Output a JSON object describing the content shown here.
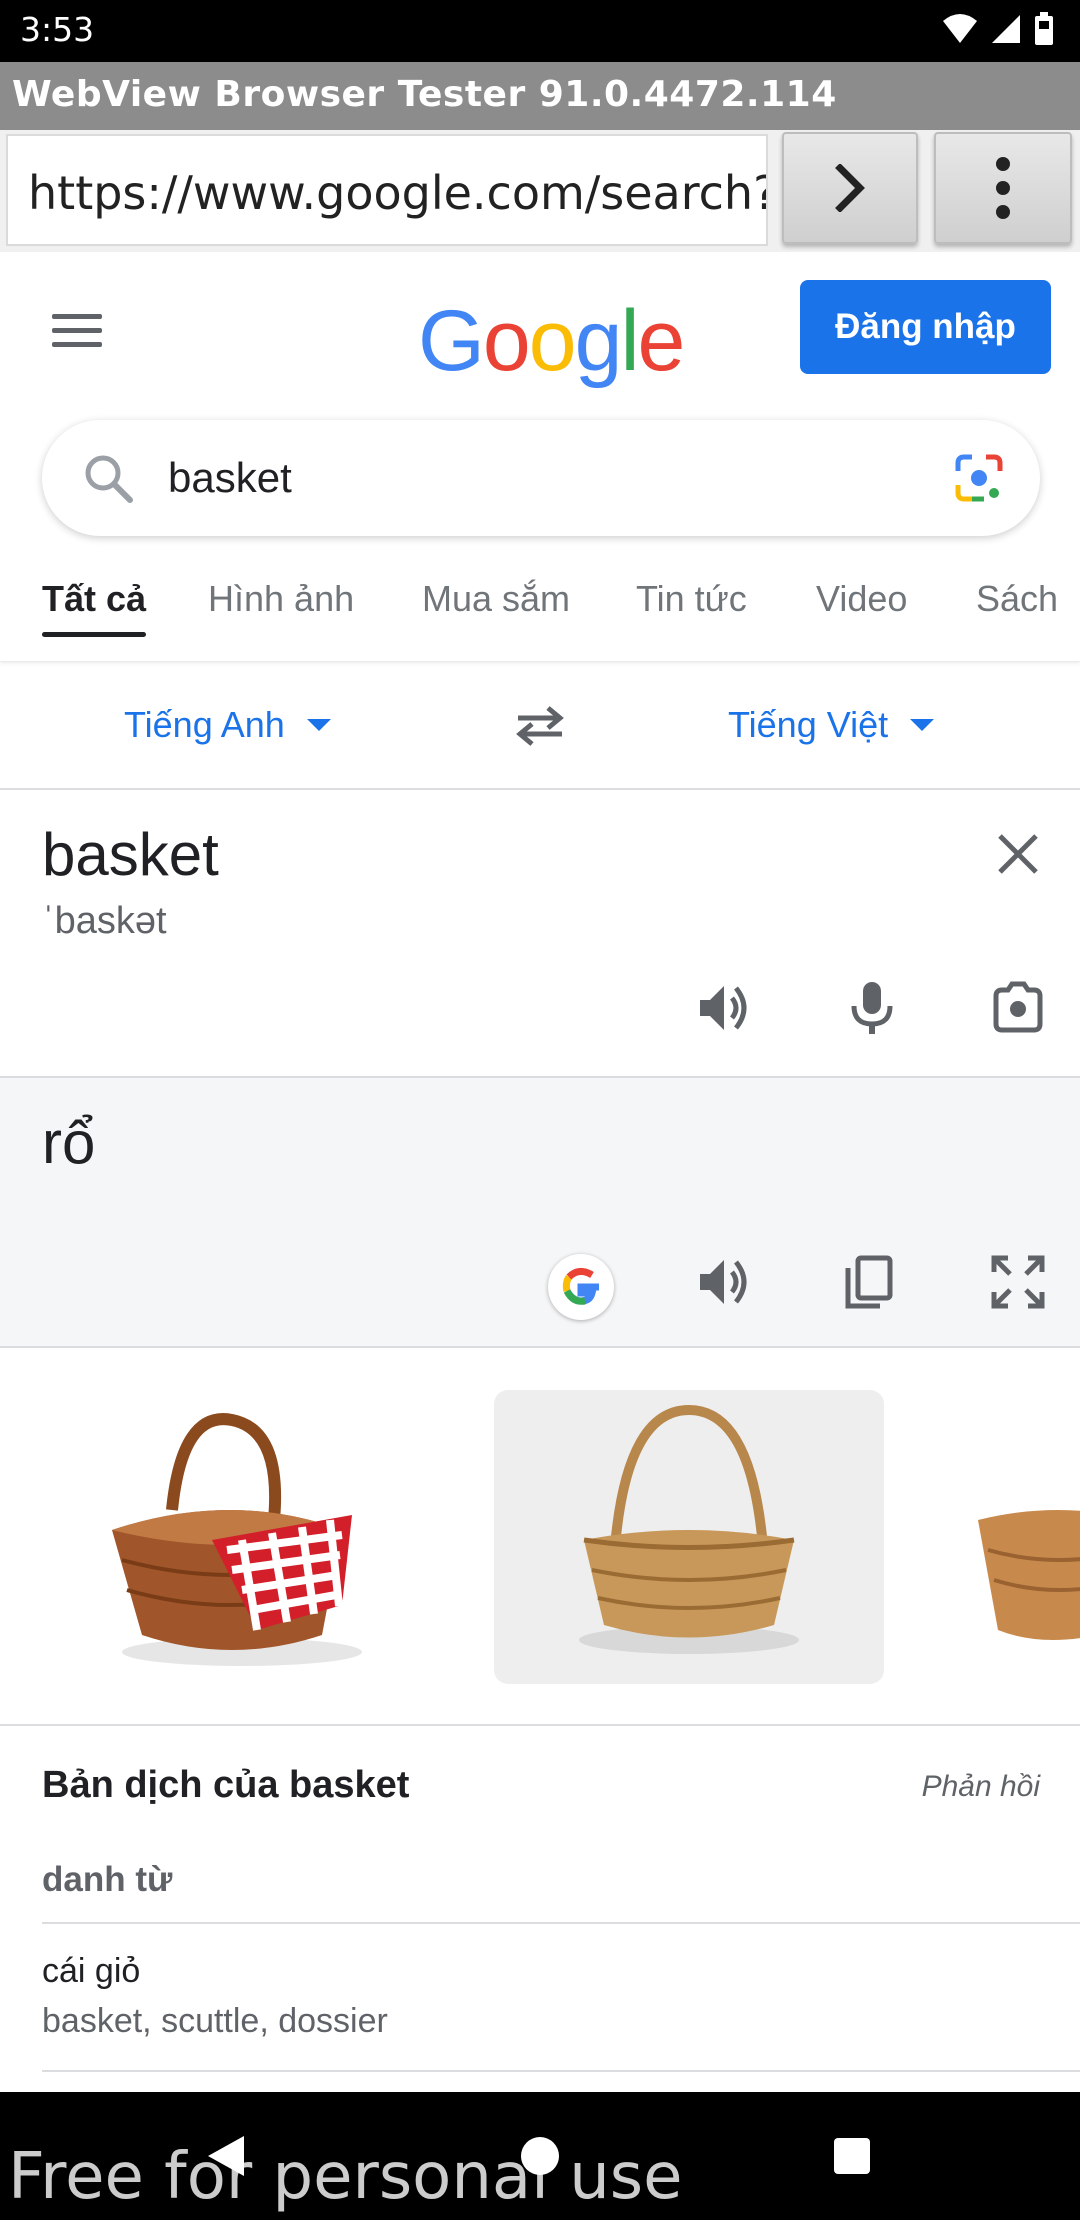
{
  "status_bar": {
    "time": "3:53"
  },
  "app": {
    "title": "WebView Browser Tester 91.0.4472.114"
  },
  "browser": {
    "url": "https://www.google.com/search?q"
  },
  "google": {
    "logo": [
      "G",
      "o",
      "o",
      "g",
      "l",
      "e"
    ],
    "logo_colors": [
      "#4285F4",
      "#EA4335",
      "#FBBC05",
      "#4285F4",
      "#34A853",
      "#EA4335"
    ],
    "signin_label": "Đăng nhập",
    "query": "basket"
  },
  "tabs": [
    {
      "label": "Tất cả",
      "active": true
    },
    {
      "label": "Hình ảnh"
    },
    {
      "label": "Mua sắm"
    },
    {
      "label": "Tin tức"
    },
    {
      "label": "Video"
    },
    {
      "label": "Sách"
    }
  ],
  "translate": {
    "source_lang": "Tiếng Anh",
    "target_lang": "Tiếng Việt",
    "source_word": "basket",
    "phonetic": "ˈbaskət",
    "translation": "rổ"
  },
  "dictionary": {
    "title": "Bản dịch của basket",
    "feedback": "Phản hồi",
    "part_of_speech": "danh từ",
    "entries": [
      {
        "word": "cái giỏ",
        "synonyms": "basket, scuttle, dossier"
      }
    ]
  },
  "watermark": "Free for personal use",
  "colors": {
    "accent": "#1a73e8",
    "sign_in_bg": "#1a73e8",
    "target_bg": "#f5f6f7"
  },
  "icons": [
    "wifi-icon",
    "signal-icon",
    "battery-icon",
    "forward-arrow-icon",
    "overflow-menu-icon",
    "hamburger-menu-icon",
    "search-icon",
    "google-lens-icon",
    "swap-languages-icon",
    "clear-icon",
    "speaker-icon",
    "microphone-icon",
    "camera-icon",
    "google-g-icon",
    "copy-icon",
    "fullscreen-icon",
    "back-nav-icon",
    "home-nav-icon",
    "recents-nav-icon"
  ]
}
